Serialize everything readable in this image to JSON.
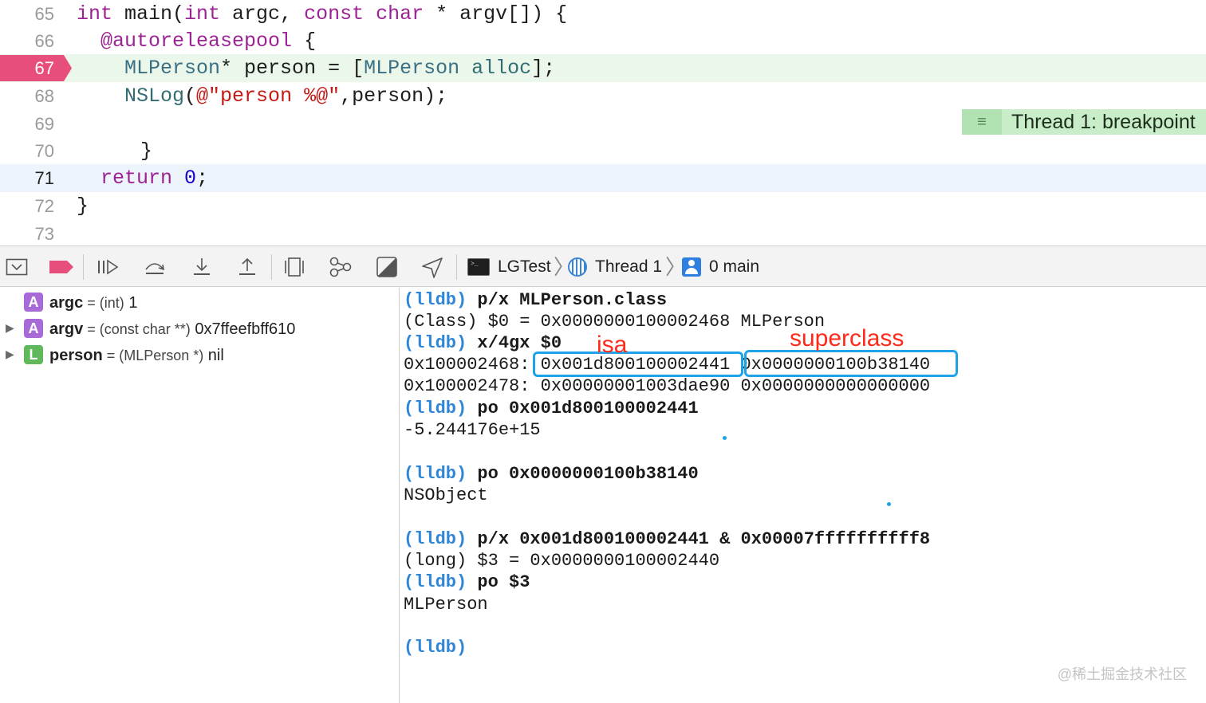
{
  "editor": {
    "lines": [
      {
        "num": "65"
      },
      {
        "num": "66"
      },
      {
        "num": "67"
      },
      {
        "num": "68"
      },
      {
        "num": "69"
      },
      {
        "num": "70"
      },
      {
        "num": "71"
      },
      {
        "num": "72"
      },
      {
        "num": "73"
      }
    ],
    "code": {
      "l65_int1": "int",
      "l65_main": " main(",
      "l65_int2": "int",
      "l65_argc": " argc, ",
      "l65_const": "const",
      "l65_sp": " ",
      "l65_char": "char",
      "l65_rest": " * argv[]) {",
      "l66_pool": "@autoreleasepool",
      "l66_brace": " {",
      "l67_cls": "MLPerson",
      "l67_a": "* person = [",
      "l67_cls2": "MLPerson",
      "l67_sp": " ",
      "l67_alloc": "alloc",
      "l67_end": "];",
      "l68_nslog": "NSLog",
      "l68_paren": "(",
      "l68_str": "@\"person %@\"",
      "l68_end": ",person);",
      "l70_brace": "}",
      "l71_ret": "return",
      "l71_sp": " ",
      "l71_zero": "0",
      "l71_semi": ";",
      "l72_brace": "}"
    },
    "breakpoint_badge": "Thread 1: breakpoint"
  },
  "debugbar": {
    "crumbs": {
      "target": "LGTest",
      "thread": "Thread 1",
      "frame": "0 main"
    },
    "icons": [
      "hide-debug-area-icon",
      "breakpoints-toggle-icon",
      "continue-icon",
      "step-over-icon",
      "step-into-icon",
      "step-out-icon",
      "view-debugger-icon",
      "memory-graph-icon",
      "environment-overrides-icon",
      "simulate-location-icon"
    ]
  },
  "variables": [
    {
      "badge": "A",
      "name": "argc",
      "eq": " = ",
      "type": "(int)",
      "value": " 1"
    },
    {
      "badge": "A",
      "name": "argv",
      "eq": " = ",
      "type": "(const char **)",
      "value": " 0x7ffeefbff610"
    },
    {
      "badge": "L",
      "name": "person",
      "eq": " = ",
      "type": "(MLPerson *)",
      "value": " nil"
    }
  ],
  "console": {
    "prompt": "(lldb)",
    "c1_cmd": " p/x MLPerson.class",
    "c2_out": "(Class) $0 = 0x0000000100002468 MLPerson",
    "c3_cmd": " x/4gx $0",
    "c4_addr": "0x100002468: ",
    "c4_v1": "0x001d800100002441",
    "c4_sp": " ",
    "c4_v2": "0x0000000100b38140",
    "c5_out": "0x100002478: 0x00000001003dae90 0x0000000000000000",
    "c6_cmd": " po 0x001d800100002441",
    "c7_out": "-5.244176e+15",
    "c9_cmd": " po 0x0000000100b38140",
    "c10_out": "NSObject",
    "c12_cmd": " p/x 0x001d800100002441 & 0x00007ffffffffff8",
    "c13_out": "(long) $3 = 0x0000000100002440",
    "c14_cmd": " po $3",
    "c15_out": "MLPerson",
    "annot_isa": "isa",
    "annot_superclass": "superclass"
  },
  "watermark": "@稀土掘金技术社区",
  "colors": {
    "breakpoint": "#e84e7c",
    "current_line": "#eef4fb",
    "badge_green": "#c9ecc9",
    "prompt_blue": "#2f86d6",
    "highlight_box": "#1fa3e8",
    "annotation_red": "#ff2a1a"
  }
}
